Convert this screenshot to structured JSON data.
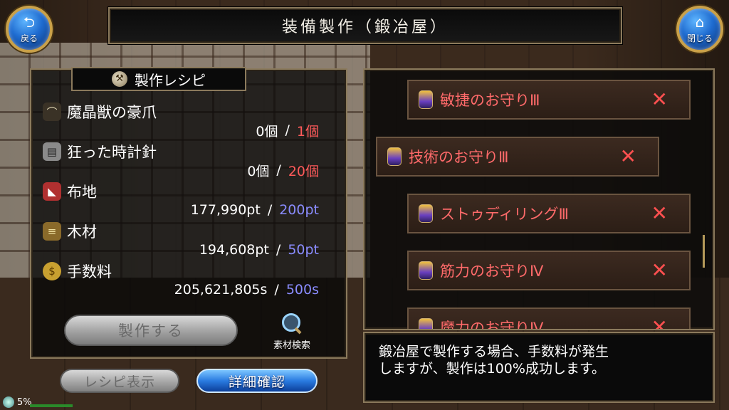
{
  "header": {
    "title": "装備製作（鍛冶屋）",
    "back_label": "戻る",
    "close_label": "閉じる"
  },
  "recipe_panel": {
    "title": "製作レシピ",
    "materials": [
      {
        "name": "魔晶獣の豪爪",
        "have": "0個",
        "need": "1個",
        "need_color": "red"
      },
      {
        "name": "狂った時計針",
        "have": "0個",
        "need": "20個",
        "need_color": "red"
      },
      {
        "name": "布地",
        "have": "177,990pt",
        "need": "200pt",
        "need_color": "blue"
      },
      {
        "name": "木材",
        "have": "194,608pt",
        "need": "50pt",
        "need_color": "blue"
      },
      {
        "name": "手数料",
        "have": "205,621,805s",
        "need": "500s",
        "need_color": "blue"
      }
    ],
    "separator": "/",
    "craft_button": "製作する",
    "search_material": "素材検索"
  },
  "bottom_buttons": {
    "recipe_view": "レシピ表示",
    "detail_check": "詳細確認"
  },
  "status": {
    "percent": "5%"
  },
  "recipe_list": [
    {
      "name": "敏捷のお守りⅢ",
      "mark": "✕"
    },
    {
      "name": "技術のお守りⅢ",
      "mark": "✕"
    },
    {
      "name": "ストゥディリングⅢ",
      "mark": "✕"
    },
    {
      "name": "筋力のお守りⅣ",
      "mark": "✕"
    },
    {
      "name": "魔力のお守りⅣ",
      "mark": "✕"
    }
  ],
  "message": {
    "line1": "鍛冶屋で製作する場合、手数料が発生",
    "line2": "しますが、製作は100%成功します。"
  },
  "colors": {
    "need_red": "#ff5a5a",
    "need_blue": "#8a8cff",
    "recipe_name": "#ff6a6a",
    "frame": "#8b7a5c"
  },
  "icons": {
    "back": "back-arrow-icon",
    "close": "home-icon",
    "recipe_header": "anvil-icon",
    "search": "magnifier-icon",
    "recipe_item": "charm-icon",
    "unavailable": "cross-icon"
  }
}
